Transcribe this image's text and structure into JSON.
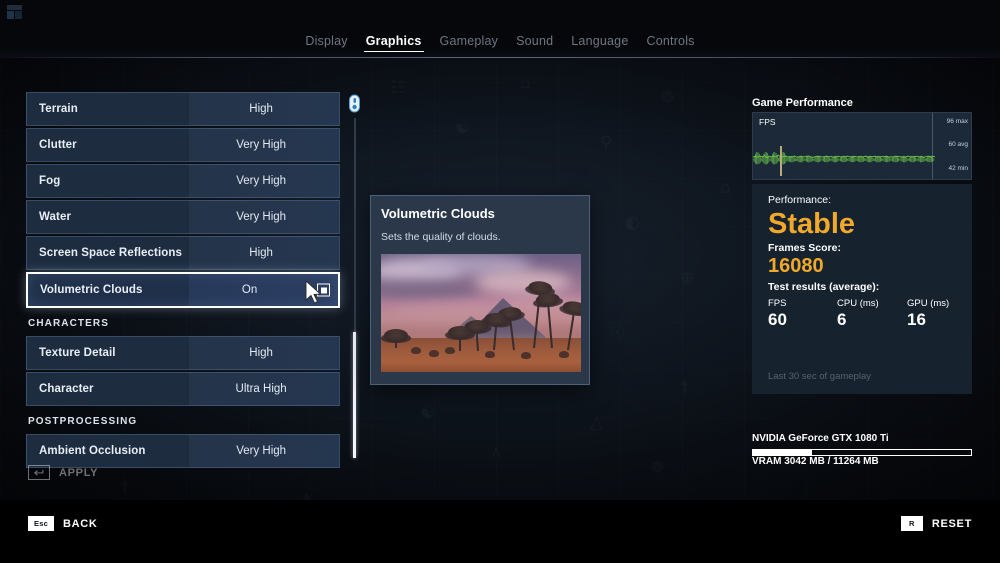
{
  "window": {
    "app_badge_icon": "app-badge-icon"
  },
  "tabs": [
    {
      "label": "Display",
      "active": false
    },
    {
      "label": "Graphics",
      "active": true
    },
    {
      "label": "Gameplay",
      "active": false
    },
    {
      "label": "Sound",
      "active": false
    },
    {
      "label": "Language",
      "active": false
    },
    {
      "label": "Controls",
      "active": false
    }
  ],
  "settings": {
    "rows": [
      {
        "type": "option",
        "label": "Terrain",
        "value": "High",
        "selected": false
      },
      {
        "type": "option",
        "label": "Clutter",
        "value": "Very High",
        "selected": false
      },
      {
        "type": "option",
        "label": "Fog",
        "value": "Very High",
        "selected": false
      },
      {
        "type": "option",
        "label": "Water",
        "value": "Very High",
        "selected": false
      },
      {
        "type": "option",
        "label": "Screen Space Reflections",
        "value": "High",
        "selected": false
      },
      {
        "type": "toggle",
        "label": "Volumetric Clouds",
        "value": "On",
        "selected": true,
        "checked": true
      },
      {
        "type": "section",
        "label": "CHARACTERS"
      },
      {
        "type": "option",
        "label": "Texture Detail",
        "value": "High",
        "selected": false
      },
      {
        "type": "option",
        "label": "Character",
        "value": "Ultra High",
        "selected": false
      },
      {
        "type": "section",
        "label": "POSTPROCESSING"
      },
      {
        "type": "option",
        "label": "Ambient Occlusion",
        "value": "Very High",
        "selected": false
      }
    ],
    "scroll_icon": "mouse-scroll-icon"
  },
  "tooltip": {
    "title": "Volumetric Clouds",
    "description": "Sets the quality of clouds.",
    "preview_alt": "desert-sunset-palm-trees-preview"
  },
  "performance": {
    "panel_title": "Game Performance",
    "graph": {
      "series_label": "FPS",
      "max_label": "96 max",
      "avg_label": "60 avg",
      "min_label": "42 min"
    },
    "performance_label": "Performance:",
    "performance_value": "Stable",
    "frames_score_label": "Frames Score:",
    "frames_score_value": "16080",
    "test_results_label": "Test results (average):",
    "stats": [
      {
        "name": "FPS",
        "value": "60"
      },
      {
        "name": "CPU (ms)",
        "value": "6"
      },
      {
        "name": "GPU (ms)",
        "value": "16"
      }
    ],
    "footnote": "Last 30 sec of gameplay",
    "accent_color": "#f0a92a"
  },
  "gpu": {
    "name": "NVIDIA GeForce GTX 1080 Ti",
    "vram_text": "VRAM 3042 MB / 11264 MB",
    "vram_percent": 27
  },
  "footer": {
    "apply_key": "Enter",
    "apply_label": "APPLY",
    "back_key": "Esc",
    "back_label": "BACK",
    "reset_key": "R",
    "reset_label": "RESET"
  },
  "chart_data": {
    "type": "line",
    "title": "FPS",
    "ylabel": "FPS",
    "ylim": [
      42,
      96
    ],
    "ticks": [
      96,
      60,
      42
    ],
    "tick_labels": [
      "96 max",
      "60 avg",
      "42 min"
    ],
    "grid": false,
    "series": [
      {
        "name": "FPS",
        "color": "#6cc24a",
        "values": [
          58,
          62,
          57,
          64,
          59,
          66,
          55,
          61,
          60,
          63,
          57,
          68,
          59,
          60,
          62,
          58,
          61,
          59,
          63,
          57,
          60,
          62,
          58,
          61,
          64,
          59,
          57,
          60,
          62,
          61,
          58,
          60,
          63,
          59,
          61,
          57,
          60,
          62,
          58,
          61,
          59,
          63,
          60,
          57,
          62,
          58,
          61,
          60,
          59,
          63,
          57,
          61,
          60,
          62,
          58,
          59,
          61,
          60,
          63,
          57,
          60,
          58,
          62,
          61,
          59,
          60,
          57,
          63,
          61,
          58,
          60,
          62,
          59,
          61,
          57,
          60,
          63,
          58,
          62,
          60
        ]
      }
    ]
  }
}
